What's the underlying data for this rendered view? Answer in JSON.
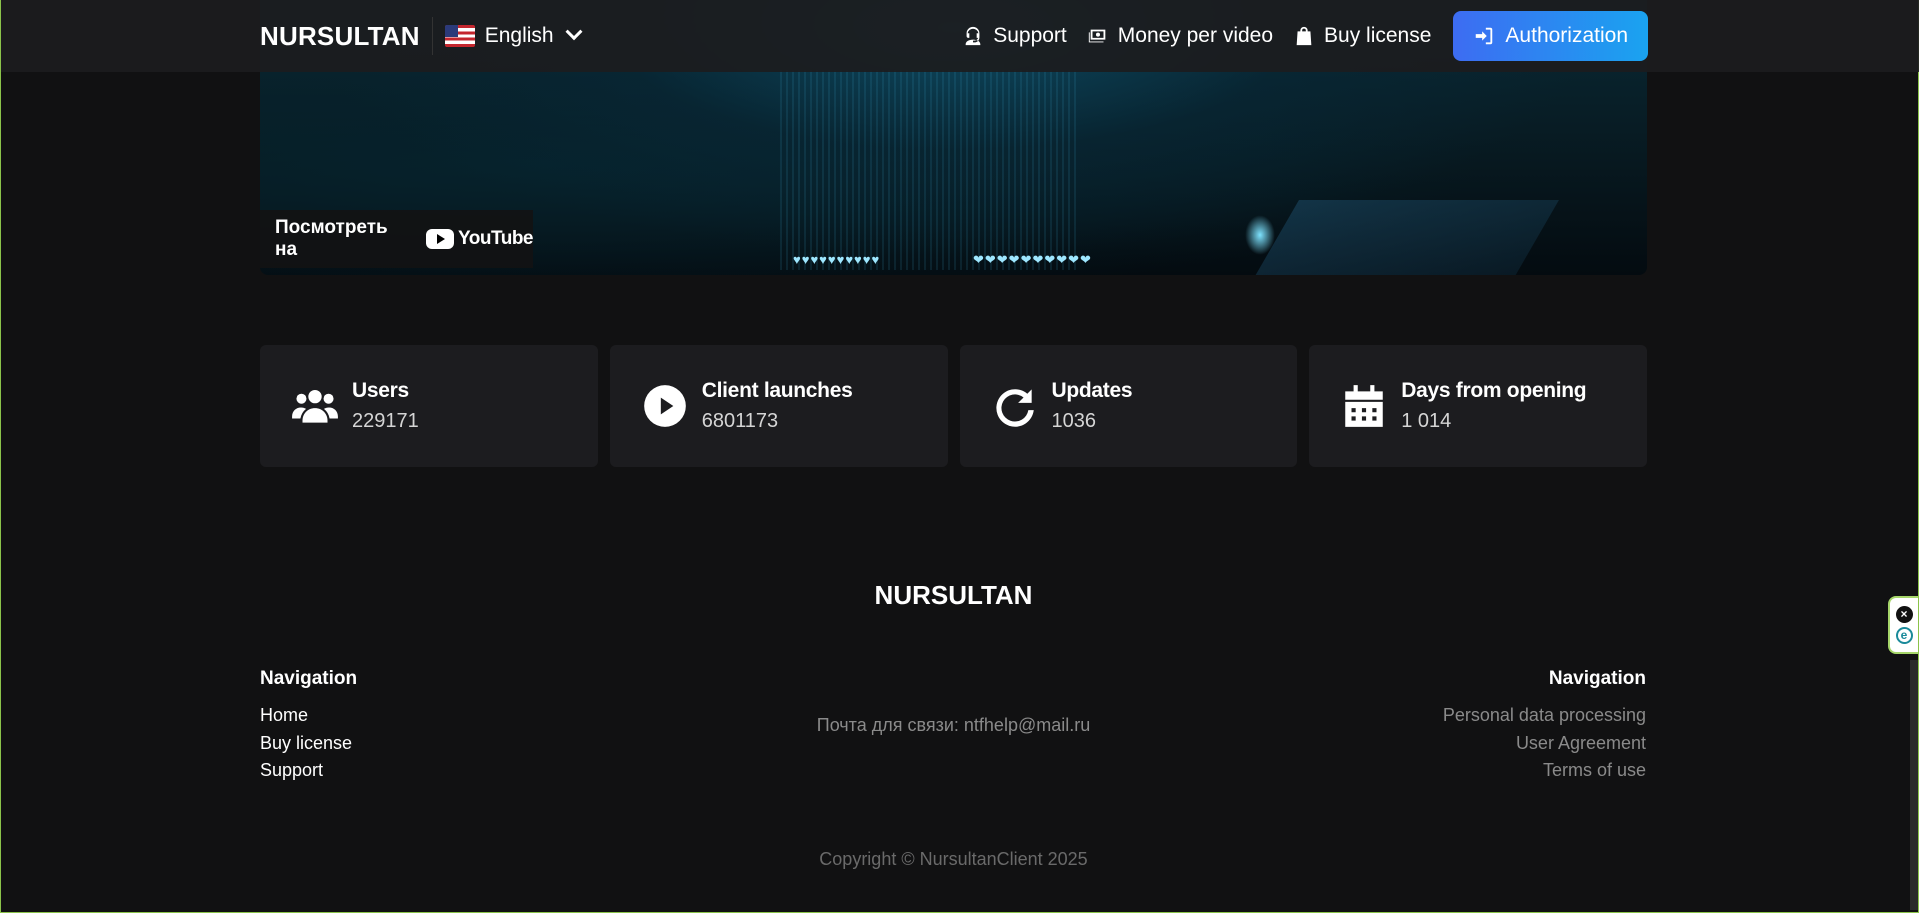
{
  "header": {
    "brand": "NURSULTAN",
    "language": "English",
    "nav": {
      "support": "Support",
      "money_per_video": "Money per video",
      "buy_license": "Buy license",
      "authorization": "Authorization"
    }
  },
  "video": {
    "watch_on": "Посмотреть на",
    "youtube": "YouTube",
    "hearts_left": "♥♥♥♥♥♥♥♥♥♥",
    "hearts_right": "❤❤❤❤❤❤❤❤❤❤"
  },
  "stats": [
    {
      "title": "Users",
      "value": "229171",
      "icon": "users-icon"
    },
    {
      "title": "Client launches",
      "value": "6801173",
      "icon": "play-circle-icon"
    },
    {
      "title": "Updates",
      "value": "1036",
      "icon": "refresh-icon"
    },
    {
      "title": "Days from opening",
      "value": "1 014",
      "icon": "calendar-icon"
    }
  ],
  "footer": {
    "brand": "NURSULTAN",
    "left": {
      "heading": "Navigation",
      "links": [
        "Home",
        "Buy license",
        "Support"
      ]
    },
    "contact": "Почта для связи: ntfhelp@mail.ru",
    "right": {
      "heading": "Navigation",
      "links": [
        "Personal data processing",
        "User Agreement",
        "Terms of use"
      ]
    },
    "copyright": "Copyright © NursultanClient 2025"
  },
  "colors": {
    "background": "#111112",
    "card": "#1c1c1f",
    "accent_start": "#3d6cf2",
    "accent_end": "#1aa3f0"
  }
}
